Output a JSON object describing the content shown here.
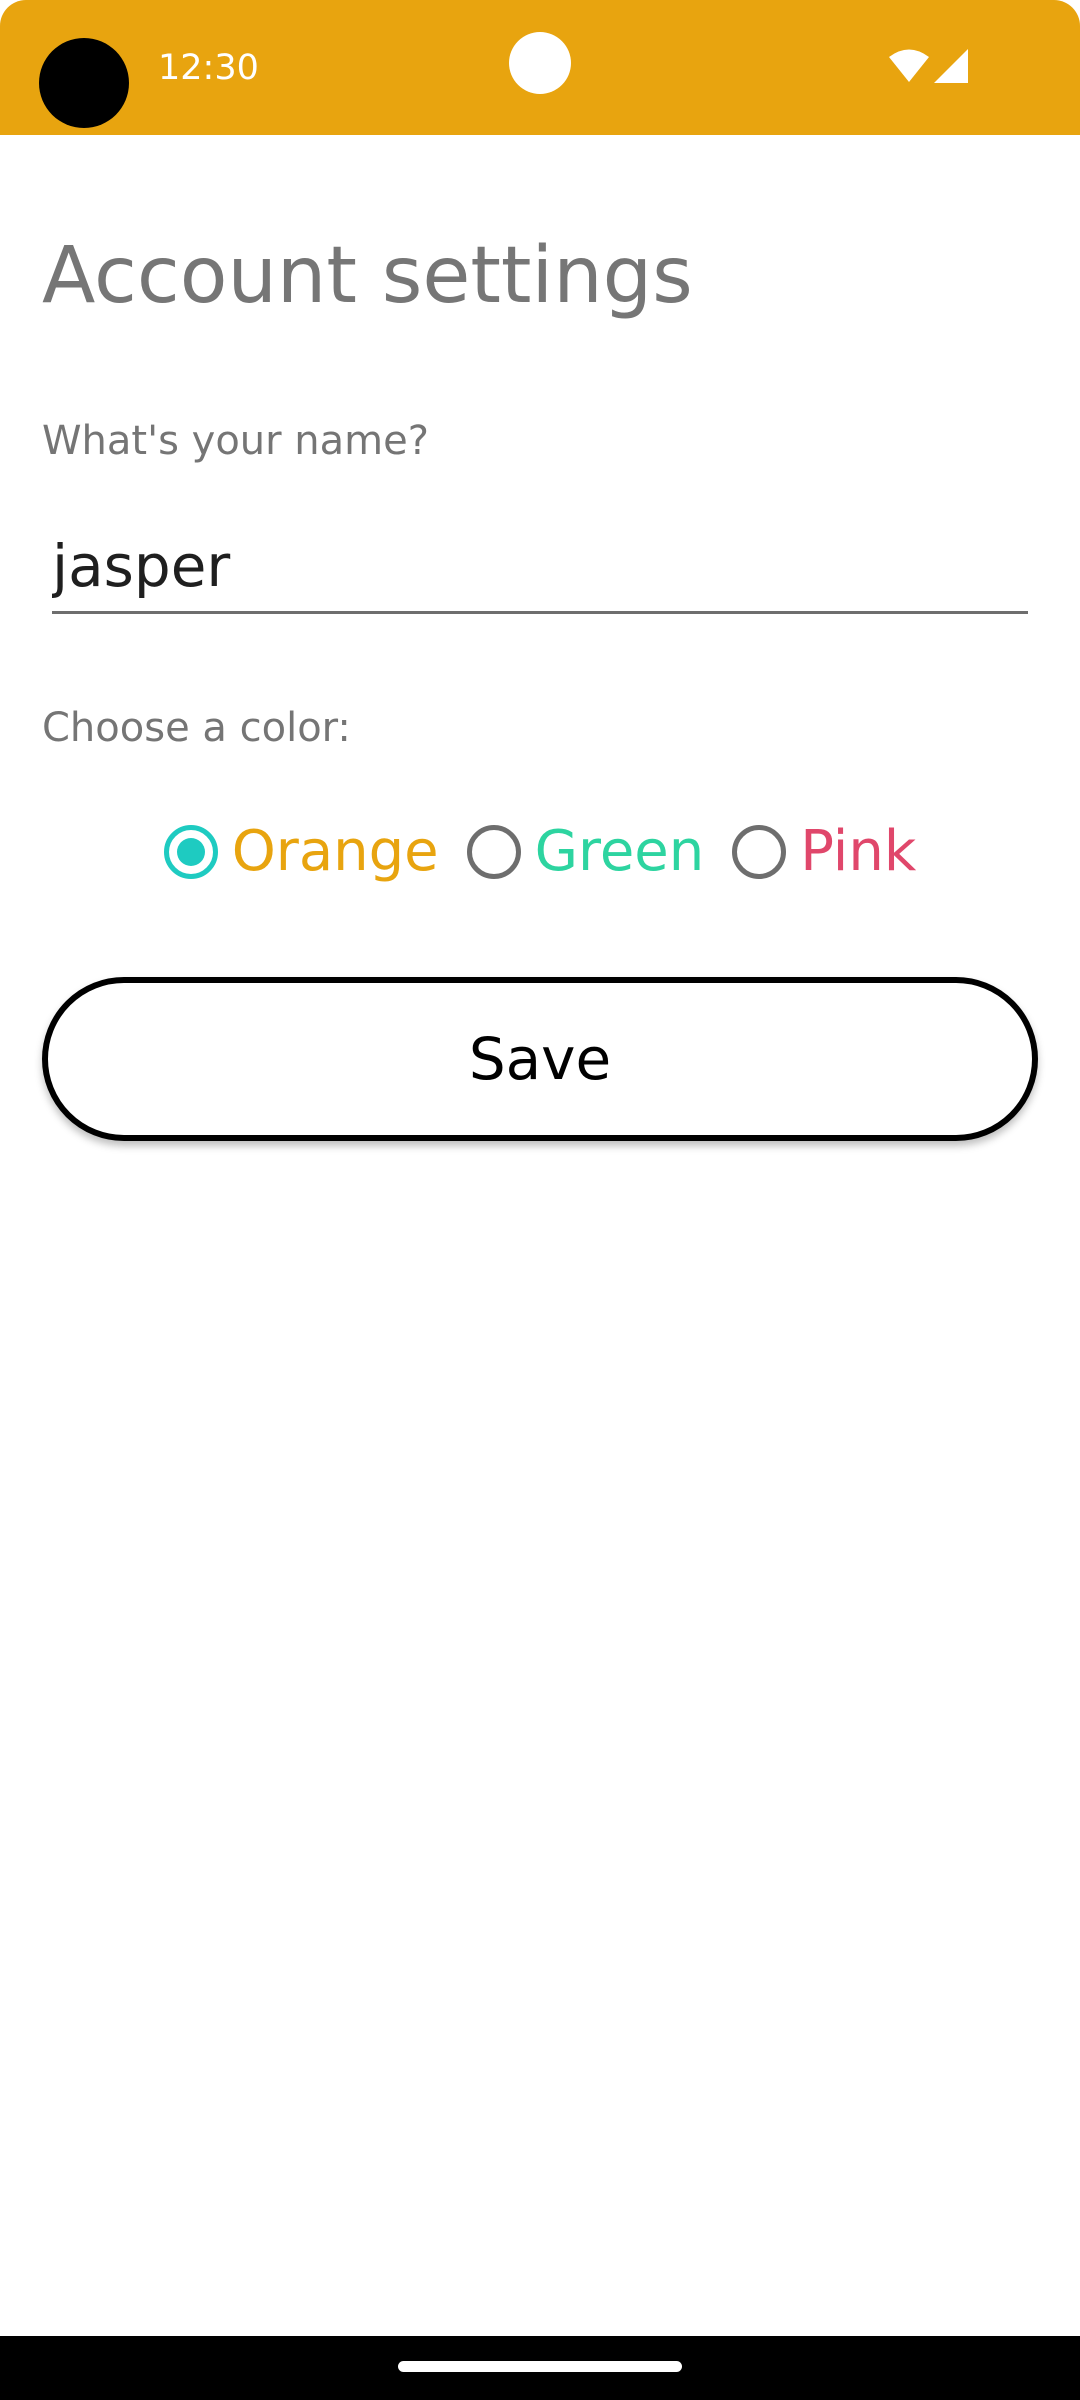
{
  "status_bar": {
    "time": "12:30",
    "background_color": "#E8A40F",
    "icons": [
      "camera-icon",
      "wifi-icon",
      "signal-icon"
    ]
  },
  "page": {
    "title": "Account settings"
  },
  "name_field": {
    "label": "What's your name?",
    "value": "jasper"
  },
  "color_choice": {
    "label": "Choose a color:",
    "selected": "Orange",
    "options": [
      {
        "label": "Orange",
        "color": "#E8A40F",
        "checked": true
      },
      {
        "label": "Green",
        "color": "#2DD4A0",
        "checked": false
      },
      {
        "label": "Pink",
        "color": "#E0476B",
        "checked": false
      }
    ],
    "accent_color": "#1ECBC1"
  },
  "actions": {
    "save_label": "Save"
  },
  "navigation_bar": {
    "icons": [
      "home-indicator"
    ]
  }
}
